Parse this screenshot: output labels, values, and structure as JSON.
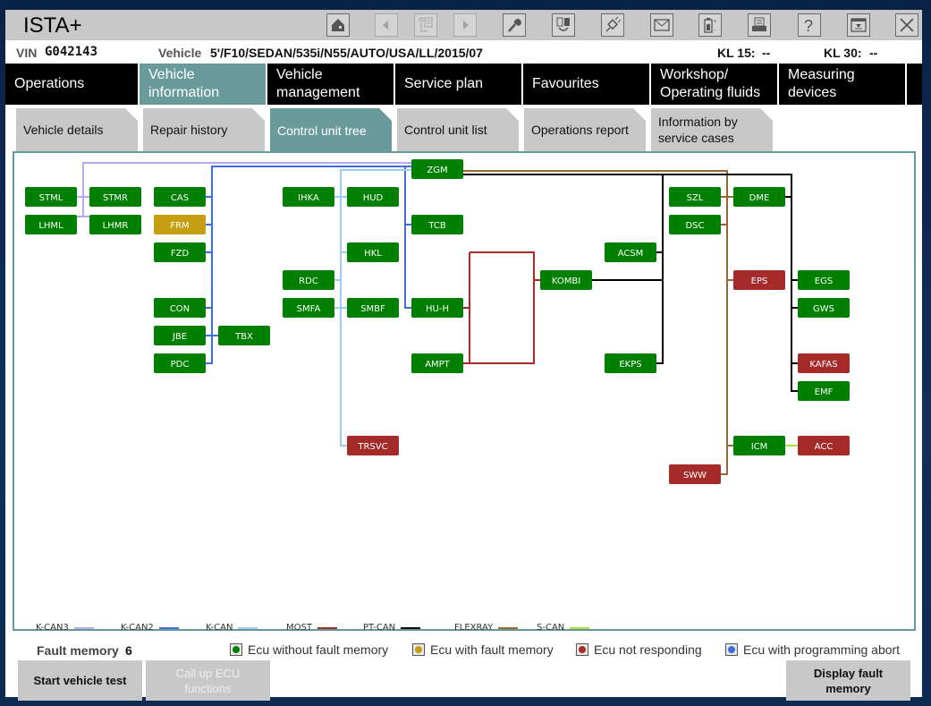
{
  "app": {
    "title": "ISTA+",
    "toolbar": [
      {
        "name": "home-icon",
        "label": "Home",
        "enabled": true
      },
      {
        "name": "back-icon",
        "label": "Back",
        "enabled": false
      },
      {
        "name": "copy-document-icon",
        "label": "Copy",
        "enabled": false
      },
      {
        "name": "forward-icon",
        "label": "Forward",
        "enabled": false
      },
      {
        "name": "wrench-icon",
        "label": "Workshop",
        "enabled": true
      },
      {
        "name": "ecu-swap-icon",
        "label": "ECU swap",
        "enabled": true
      },
      {
        "name": "connector-icon",
        "label": "Connection",
        "enabled": true
      },
      {
        "name": "mail-icon",
        "label": "Message",
        "enabled": true
      },
      {
        "name": "battery-icon",
        "label": "Battery",
        "enabled": true
      },
      {
        "name": "printer-icon",
        "label": "Print",
        "enabled": true
      },
      {
        "name": "help-icon",
        "label": "Help",
        "enabled": true
      },
      {
        "name": "minimize-icon",
        "label": "Minimize",
        "enabled": true
      },
      {
        "name": "close-icon",
        "label": "Close",
        "enabled": true
      }
    ]
  },
  "info": {
    "vin_label": "VIN",
    "vin_value": "G042143",
    "vehicle_label": "Vehicle",
    "vehicle_value": "5'/F10/SEDAN/535i/N55/AUTO/USA/LL/2015/07",
    "kl15_label": "KL 15:",
    "kl15_value": "--",
    "kl30_label": "KL 30:",
    "kl30_value": "--"
  },
  "main_nav": [
    {
      "label": "Operations",
      "active": false
    },
    {
      "label": "Vehicle information",
      "active": true
    },
    {
      "label": "Vehicle management",
      "active": false
    },
    {
      "label": "Service plan",
      "active": false
    },
    {
      "label": "Favourites",
      "active": false
    },
    {
      "label": "Workshop/ Operating fluids",
      "active": false
    },
    {
      "label": "Measuring devices",
      "active": false
    }
  ],
  "sub_tabs": [
    {
      "label": "Vehicle details",
      "active": false
    },
    {
      "label": "Repair history",
      "active": false
    },
    {
      "label": "Control unit tree",
      "active": true
    },
    {
      "label": "Control unit list",
      "active": false
    },
    {
      "label": "Operations report",
      "active": false
    },
    {
      "label": "Information by service cases",
      "active": false
    }
  ],
  "status_colors": {
    "ok": "#007f00",
    "fault": "#c59e12",
    "not_responding": "#a52a2a",
    "programming_abort": "#3a6ee0"
  },
  "buses": [
    {
      "name": "K-CAN3",
      "color": "#b9a9ec"
    },
    {
      "name": "K-CAN2",
      "color": "#3d6ee0"
    },
    {
      "name": "K-CAN",
      "color": "#9dcdf5"
    },
    {
      "name": "MOST",
      "color": "#a52a2a"
    },
    {
      "name": "PT-CAN",
      "color": "#000000"
    },
    {
      "name": "FLEXRAY",
      "color": "#9a6834"
    },
    {
      "name": "S-CAN",
      "color": "#a6e63c"
    }
  ],
  "ecus": [
    {
      "id": "STML",
      "status": "ok"
    },
    {
      "id": "STMR",
      "status": "ok"
    },
    {
      "id": "LHML",
      "status": "ok"
    },
    {
      "id": "LHMR",
      "status": "ok"
    },
    {
      "id": "CAS",
      "status": "ok"
    },
    {
      "id": "FRM",
      "status": "fault"
    },
    {
      "id": "FZD",
      "status": "ok"
    },
    {
      "id": "CON",
      "status": "ok"
    },
    {
      "id": "JBE",
      "status": "ok"
    },
    {
      "id": "TBX",
      "status": "ok"
    },
    {
      "id": "PDC",
      "status": "ok"
    },
    {
      "id": "IHKA",
      "status": "ok"
    },
    {
      "id": "HUD",
      "status": "ok"
    },
    {
      "id": "HKL",
      "status": "ok"
    },
    {
      "id": "RDC",
      "status": "ok"
    },
    {
      "id": "SMFA",
      "status": "ok"
    },
    {
      "id": "SMBF",
      "status": "ok"
    },
    {
      "id": "TRSVC",
      "status": "not_responding"
    },
    {
      "id": "ZGM",
      "status": "ok"
    },
    {
      "id": "TCB",
      "status": "ok"
    },
    {
      "id": "HU-H",
      "status": "ok"
    },
    {
      "id": "AMPT",
      "status": "ok"
    },
    {
      "id": "KOMBI",
      "status": "ok"
    },
    {
      "id": "ACSM",
      "status": "ok"
    },
    {
      "id": "EKPS",
      "status": "ok"
    },
    {
      "id": "SZL",
      "status": "ok"
    },
    {
      "id": "DSC",
      "status": "ok"
    },
    {
      "id": "SWW",
      "status": "not_responding"
    },
    {
      "id": "DME",
      "status": "ok"
    },
    {
      "id": "EPS",
      "status": "not_responding"
    },
    {
      "id": "ICM",
      "status": "ok"
    },
    {
      "id": "EGS",
      "status": "ok"
    },
    {
      "id": "GWS",
      "status": "ok"
    },
    {
      "id": "KAFAS",
      "status": "not_responding"
    },
    {
      "id": "EMF",
      "status": "ok"
    },
    {
      "id": "ACC",
      "status": "not_responding"
    }
  ],
  "status_legend": {
    "fault_memory_label": "Fault memory",
    "fault_memory_count": "6",
    "items": [
      {
        "label": "Ecu without fault memory",
        "status": "ok"
      },
      {
        "label": "Ecu with fault memory",
        "status": "fault"
      },
      {
        "label": "Ecu not responding",
        "status": "not_responding"
      },
      {
        "label": "Ecu with programming abort",
        "status": "programming_abort"
      }
    ]
  },
  "buttons": {
    "start_vehicle_test": "Start vehicle test",
    "call_up_ecu_functions": "Call up ECU functions",
    "display_fault_memory": "Display fault memory"
  }
}
